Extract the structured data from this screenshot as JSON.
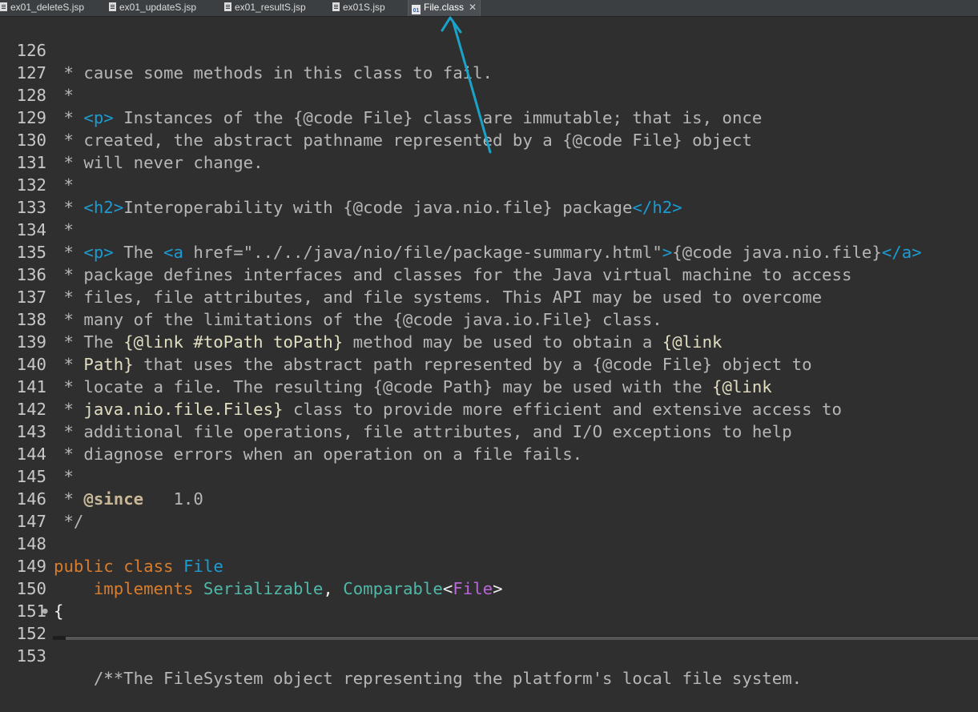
{
  "tabs": [
    {
      "label": "ex01_deleteS.jsp",
      "icon": "jsp-file-icon",
      "active": false
    },
    {
      "label": "ex01_updateS.jsp",
      "icon": "jsp-file-icon",
      "active": false
    },
    {
      "label": "ex01_resultS.jsp",
      "icon": "jsp-file-icon",
      "active": false
    },
    {
      "label": "ex01S.jsp",
      "icon": "jsp-file-icon",
      "active": false
    },
    {
      "label": "File.class",
      "icon": "class-file-icon",
      "active": true
    }
  ],
  "lines": [
    {
      "n": "126",
      "t": " * cause some methods in this class to fail."
    },
    {
      "n": "127",
      "t": " *"
    },
    {
      "n": "128",
      "t": " * <p> Instances of the {@code File} class are immutable; that is, once"
    },
    {
      "n": "129",
      "t": " * created, the abstract pathname represented by a {@code File} object"
    },
    {
      "n": "130",
      "t": " * will never change."
    },
    {
      "n": "131",
      "t": " *"
    },
    {
      "n": "132",
      "t": " * <h2>Interoperability with {@code java.nio.file} package</h2>"
    },
    {
      "n": "133",
      "t": " *"
    },
    {
      "n": "134",
      "t": " * <p> The <a href=\"../../java/nio/file/package-summary.html\">{@code java.nio.file}</a>"
    },
    {
      "n": "135",
      "t": " * package defines interfaces and classes for the Java virtual machine to access"
    },
    {
      "n": "136",
      "t": " * files, file attributes, and file systems. This API may be used to overcome"
    },
    {
      "n": "137",
      "t": " * many of the limitations of the {@code java.io.File} class."
    },
    {
      "n": "138",
      "t": " * The {@link #toPath toPath} method may be used to obtain a {@link"
    },
    {
      "n": "139",
      "t": " * Path} that uses the abstract path represented by a {@code File} object to"
    },
    {
      "n": "140",
      "t": " * locate a file. The resulting {@code Path} may be used with the {@link"
    },
    {
      "n": "141",
      "t": " * java.nio.file.Files} class to provide more efficient and extensive access to"
    },
    {
      "n": "142",
      "t": " * additional file operations, file attributes, and I/O exceptions to help"
    },
    {
      "n": "143",
      "t": " * diagnose errors when an operation on a file fails."
    },
    {
      "n": "144",
      "t": " *"
    },
    {
      "n": "145",
      "t": " * @since   1.0"
    },
    {
      "n": "146",
      "t": " */"
    },
    {
      "n": "147",
      "t": ""
    },
    {
      "n": "148",
      "t": "public class File"
    },
    {
      "n": "149",
      "t": "    implements Serializable, Comparable<File>"
    },
    {
      "n": "150",
      "t": "{"
    },
    {
      "n": "151",
      "t": ""
    },
    {
      "n": "152",
      "t": "    /**"
    },
    {
      "n": "153",
      "t": "     * The FileSystem object representing the platform's local file system."
    }
  ],
  "colors": {
    "background": "#2f2f2f",
    "comment": "#b6b6b6",
    "html_tag": "#1d9bd1",
    "keyword": "#d97c2c",
    "type": "#1d9bd1",
    "annotation_arrow": "#1aa3c9"
  }
}
